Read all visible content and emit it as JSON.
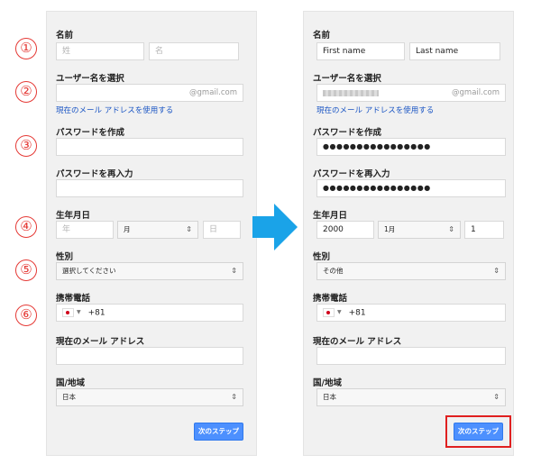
{
  "labels": {
    "name": "名前",
    "username": "ユーザー名を選択",
    "create_password": "パスワードを作成",
    "confirm_password": "パスワードを再入力",
    "birthday": "生年月日",
    "gender": "性別",
    "mobile": "携帯電話",
    "current_email": "現在のメール アドレス",
    "country": "国/地域"
  },
  "link_use_current_email": "現在のメール アドレスを使用する",
  "gmail_suffix": "@gmail.com",
  "phone_prefix": "+81",
  "next_button": "次のステップ",
  "left_form": {
    "first_name_placeholder": "姓",
    "last_name_placeholder": "名",
    "year_placeholder": "年",
    "month_select": "月",
    "day_placeholder": "日",
    "gender_select": "選択してください",
    "country_select": "日本"
  },
  "right_form": {
    "first_name": "First name",
    "last_name": "Last name",
    "password_dots": "●●●●●●●●●●●●●●●●",
    "confirm_dots": "●●●●●●●●●●●●●●●●",
    "year": "2000",
    "month": "1月",
    "day": "1",
    "gender": "その他",
    "country": "日本"
  },
  "step_numbers": [
    "①",
    "②",
    "③",
    "④",
    "⑤",
    "⑥"
  ],
  "colors": {
    "panel_bg": "#f1f1f1",
    "button_blue": "#4d90fe",
    "link_blue": "#1a55c4",
    "annotation_red": "#e53935",
    "arrow_blue": "#1aa3e8"
  }
}
